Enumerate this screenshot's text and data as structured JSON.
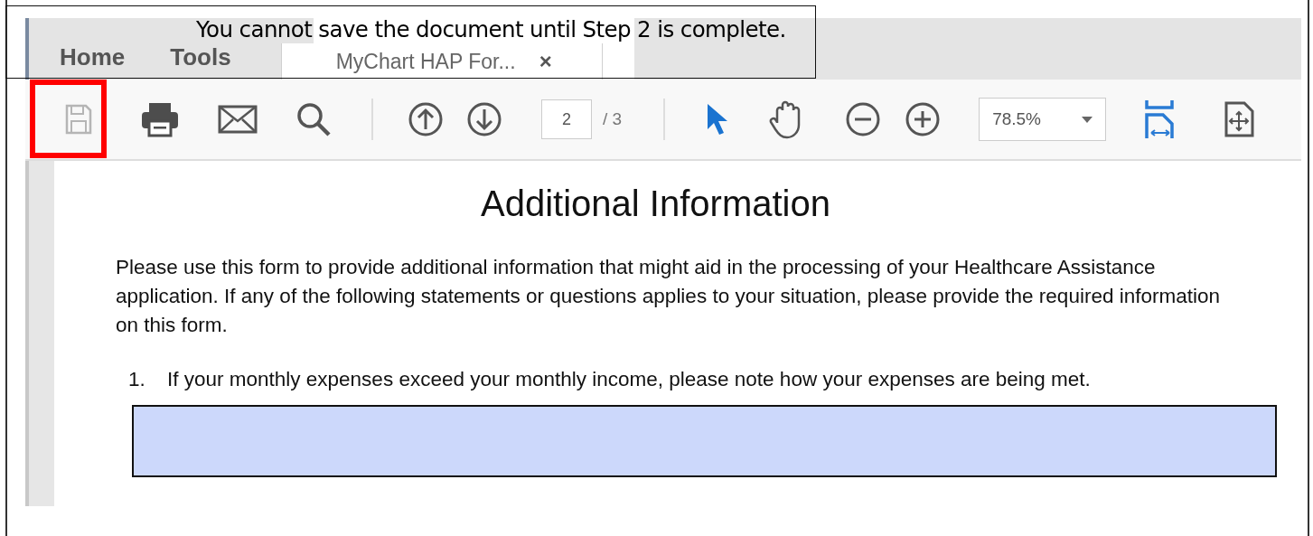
{
  "callout": {
    "text": "You cannot save the document until Step 2 is complete."
  },
  "tabs": [
    {
      "label": "Home",
      "kind": "nav",
      "selected": false
    },
    {
      "label": "Tools",
      "kind": "nav",
      "selected": false
    },
    {
      "label": "MyChart HAP For...",
      "kind": "document",
      "selected": true,
      "close": "×"
    }
  ],
  "toolbar": {
    "save": {
      "disabled": true,
      "highlighted": true
    },
    "page_field": {
      "value": "2"
    },
    "page_total": "/ 3",
    "tools": [
      {
        "selected": true
      },
      {
        "selected": false
      }
    ],
    "zoom": {
      "value": "78.5%"
    }
  },
  "document": {
    "heading": "Additional Information",
    "intro": "Please use this form to provide additional information that might aid in the processing of your Healthcare Assistance application. If any of the following statements or questions applies to your situation, please provide the required information on this form.",
    "items": [
      {
        "number": "1.",
        "text": "If your monthly expenses exceed your monthly income, please note how your expenses are being met.",
        "answer_box": true
      }
    ]
  }
}
